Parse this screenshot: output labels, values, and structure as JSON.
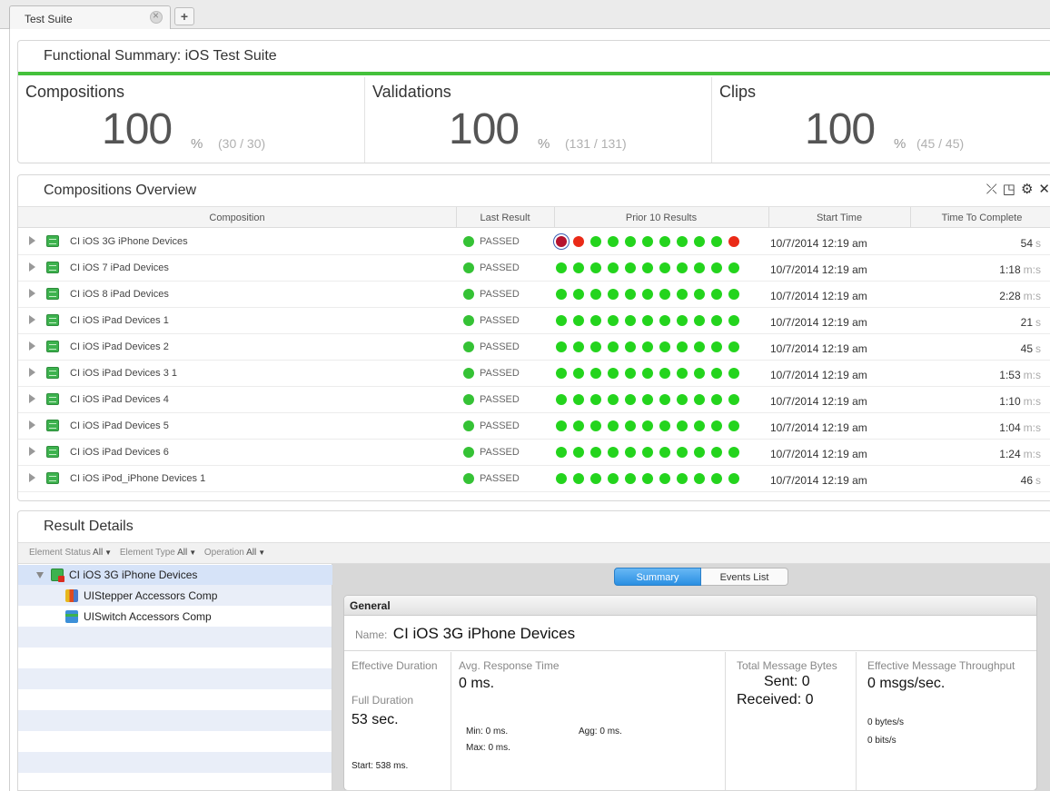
{
  "tabs": {
    "active_label": "Test Suite",
    "add_label": "+"
  },
  "summary": {
    "title": "Functional Summary: iOS Test Suite",
    "metrics": [
      {
        "label": "Compositions",
        "value": "100",
        "unit": "%",
        "count": "(30 / 30)"
      },
      {
        "label": "Validations",
        "value": "100",
        "unit": "%",
        "count": "(131 / 131)"
      },
      {
        "label": "Clips",
        "value": "100",
        "unit": "%",
        "count": "(45 / 45)"
      }
    ],
    "accent_color": "#44c13b"
  },
  "overview": {
    "title": "Compositions Overview",
    "columns": [
      "Composition",
      "Last Result",
      "Prior 10 Results",
      "Start Time",
      "Time To Complete"
    ],
    "rows": [
      {
        "name": "CI iOS 3G iPhone Devices",
        "result": "PASSED",
        "prior": [
          "ring",
          "fail",
          "pass",
          "pass",
          "pass",
          "pass",
          "pass",
          "pass",
          "pass",
          "pass",
          "fail"
        ],
        "start": "10/7/2014 12:19 am",
        "duration": "54",
        "unit": "s"
      },
      {
        "name": "CI iOS 7 iPad Devices",
        "result": "PASSED",
        "prior": [
          "pass",
          "pass",
          "pass",
          "pass",
          "pass",
          "pass",
          "pass",
          "pass",
          "pass",
          "pass",
          "pass"
        ],
        "start": "10/7/2014 12:19 am",
        "duration": "1:18",
        "unit": "m:s"
      },
      {
        "name": "CI iOS 8 iPad Devices",
        "result": "PASSED",
        "prior": [
          "pass",
          "pass",
          "pass",
          "pass",
          "pass",
          "pass",
          "pass",
          "pass",
          "pass",
          "pass",
          "pass"
        ],
        "start": "10/7/2014 12:19 am",
        "duration": "2:28",
        "unit": "m:s"
      },
      {
        "name": "CI iOS iPad Devices 1",
        "result": "PASSED",
        "prior": [
          "pass",
          "pass",
          "pass",
          "pass",
          "pass",
          "pass",
          "pass",
          "pass",
          "pass",
          "pass",
          "pass"
        ],
        "start": "10/7/2014 12:19 am",
        "duration": "21",
        "unit": "s"
      },
      {
        "name": "CI iOS iPad Devices 2",
        "result": "PASSED",
        "prior": [
          "pass",
          "pass",
          "pass",
          "pass",
          "pass",
          "pass",
          "pass",
          "pass",
          "pass",
          "pass",
          "pass"
        ],
        "start": "10/7/2014 12:19 am",
        "duration": "45",
        "unit": "s"
      },
      {
        "name": "CI iOS iPad Devices 3 1",
        "result": "PASSED",
        "prior": [
          "pass",
          "pass",
          "pass",
          "pass",
          "pass",
          "pass",
          "pass",
          "pass",
          "pass",
          "pass",
          "pass"
        ],
        "start": "10/7/2014 12:19 am",
        "duration": "1:53",
        "unit": "m:s"
      },
      {
        "name": "CI iOS iPad Devices 4",
        "result": "PASSED",
        "prior": [
          "pass",
          "pass",
          "pass",
          "pass",
          "pass",
          "pass",
          "pass",
          "pass",
          "pass",
          "pass",
          "pass"
        ],
        "start": "10/7/2014 12:19 am",
        "duration": "1:10",
        "unit": "m:s"
      },
      {
        "name": "CI iOS iPad Devices 5",
        "result": "PASSED",
        "prior": [
          "pass",
          "pass",
          "pass",
          "pass",
          "pass",
          "pass",
          "pass",
          "pass",
          "pass",
          "pass",
          "pass"
        ],
        "start": "10/7/2014 12:19 am",
        "duration": "1:04",
        "unit": "m:s"
      },
      {
        "name": "CI iOS iPad Devices 6",
        "result": "PASSED",
        "prior": [
          "pass",
          "pass",
          "pass",
          "pass",
          "pass",
          "pass",
          "pass",
          "pass",
          "pass",
          "pass",
          "pass"
        ],
        "start": "10/7/2014 12:19 am",
        "duration": "1:24",
        "unit": "m:s"
      },
      {
        "name": "CI iOS iPod_iPhone Devices 1",
        "result": "PASSED",
        "prior": [
          "pass",
          "pass",
          "pass",
          "pass",
          "pass",
          "pass",
          "pass",
          "pass",
          "pass",
          "pass",
          "pass"
        ],
        "start": "10/7/2014 12:19 am",
        "duration": "46",
        "unit": "s"
      }
    ],
    "tool_icons": [
      "collapse-icon",
      "popout-icon",
      "settings-icon",
      "close-icon"
    ],
    "colors": {
      "pass": "#24d41d",
      "fail": "#ea2a17"
    }
  },
  "details": {
    "title": "Result Details",
    "filters": [
      {
        "label": "Element Status",
        "value": "All"
      },
      {
        "label": "Element Type",
        "value": "All"
      },
      {
        "label": "Operation",
        "value": "All"
      }
    ],
    "tree": {
      "root": "CI iOS 3G iPhone Devices",
      "children": [
        "UIStepper Accessors Comp",
        "UISwitch Accessors Comp"
      ]
    },
    "segments": [
      "Summary",
      "Events List"
    ],
    "general": {
      "header": "General",
      "name_label": "Name:",
      "name_value": "CI iOS 3G iPhone Devices",
      "effective_duration_label": "Effective Duration",
      "full_duration_label": "Full Duration",
      "full_duration_value": "53 sec.",
      "start_value": "Start: 538 ms.",
      "avg_response_label": "Avg. Response Time",
      "avg_response_value": "0 ms.",
      "min_value": "Min: 0 ms.",
      "max_value": "Max: 0 ms.",
      "agg_value": "Agg: 0 ms.",
      "total_bytes_label": "Total Message Bytes",
      "sent_value": "Sent: 0",
      "received_value": "Received: 0",
      "throughput_label": "Effective Message Throughput",
      "throughput_value": "0 msgs/sec.",
      "bytes_per_sec": "0 bytes/s",
      "bits_per_sec": "0 bits/s"
    }
  }
}
